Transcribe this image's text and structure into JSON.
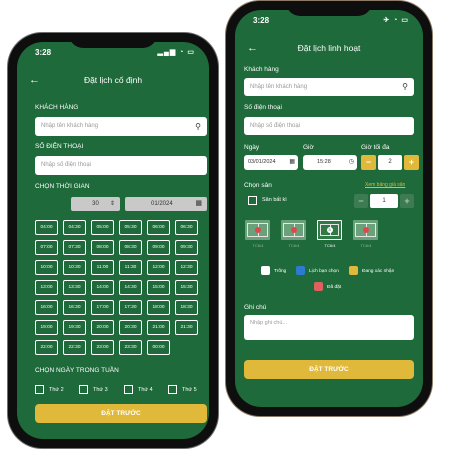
{
  "fixed": {
    "status_time": "3:28",
    "title": "Đặt lịch cố định",
    "customer_label": "KHÁCH HÀNG",
    "customer_placeholder": "Nhập tên khách hàng",
    "phone_label": "SỐ ĐIỆN THOẠI",
    "phone_placeholder": "Nhập số điện thoại",
    "time_label": "CHỌN THỜI GIAN",
    "duration_value": "30",
    "date_value": "01/2024",
    "times": [
      "04:00",
      "04:30",
      "05:00",
      "05:30",
      "06:00",
      "06:30",
      "07:00",
      "07:30",
      "08:00",
      "08:30",
      "09:00",
      "09:30",
      "10:00",
      "10:30",
      "11:00",
      "11:30",
      "12:00",
      "12:30",
      "13:00",
      "13:30",
      "14:00",
      "14:30",
      "15:00",
      "15:30",
      "16:00",
      "16:30",
      "17:00",
      "17:30",
      "18:00",
      "18:30",
      "19:00",
      "19:30",
      "20:00",
      "20:30",
      "21:00",
      "21:30",
      "22:00",
      "22:30",
      "23:00",
      "23:30",
      "00:00"
    ],
    "week_label": "CHỌN NGÀY TRONG TUẦN",
    "weekdays": [
      "Thứ 2",
      "Thứ 3",
      "Thứ 4",
      "Thứ 5"
    ],
    "submit_label": "ĐẶT TRƯỚC"
  },
  "flex": {
    "status_time": "3:28",
    "title": "Đặt lịch linh hoạt",
    "customer_label": "Khách hàng",
    "customer_placeholder": "Nhập tên khách hàng",
    "phone_label": "Số điện thoại",
    "phone_placeholder": "Nhập số điện thoại",
    "date_label": "Ngày",
    "date_value": "03/01/2024",
    "time_label": "Giờ",
    "time_value": "15:28",
    "max_hours_label": "Giờ tối đa",
    "max_hours_value": "2",
    "court_label": "Chọn sân",
    "view_table_link": "Xem bảng giá sân",
    "any_court_label": "Sân bất kì",
    "any_court_count": "1",
    "courts": [
      {
        "number": "",
        "caption": "TC6/4",
        "state": "empty"
      },
      {
        "number": "",
        "caption": "TC6/4",
        "state": "empty"
      },
      {
        "number": "3",
        "caption": "TC6/4",
        "state": "selected"
      },
      {
        "number": "",
        "caption": "TC6/4",
        "state": "empty"
      }
    ],
    "legend": [
      {
        "label": "Trống",
        "color": "#ffffff"
      },
      {
        "label": "Lịch bạn chọn",
        "color": "#2b7bd1"
      },
      {
        "label": "Đang xác nhận",
        "color": "#e0b83a"
      },
      {
        "label": "Đã đặt",
        "color": "#e06060"
      }
    ],
    "note_label": "Ghi chú",
    "note_placeholder": "Nhập ghi chú...",
    "submit_label": "ĐẶT TRƯỚC"
  },
  "colors": {
    "screen": "#1e6a3a",
    "accent": "#e0b83a"
  }
}
